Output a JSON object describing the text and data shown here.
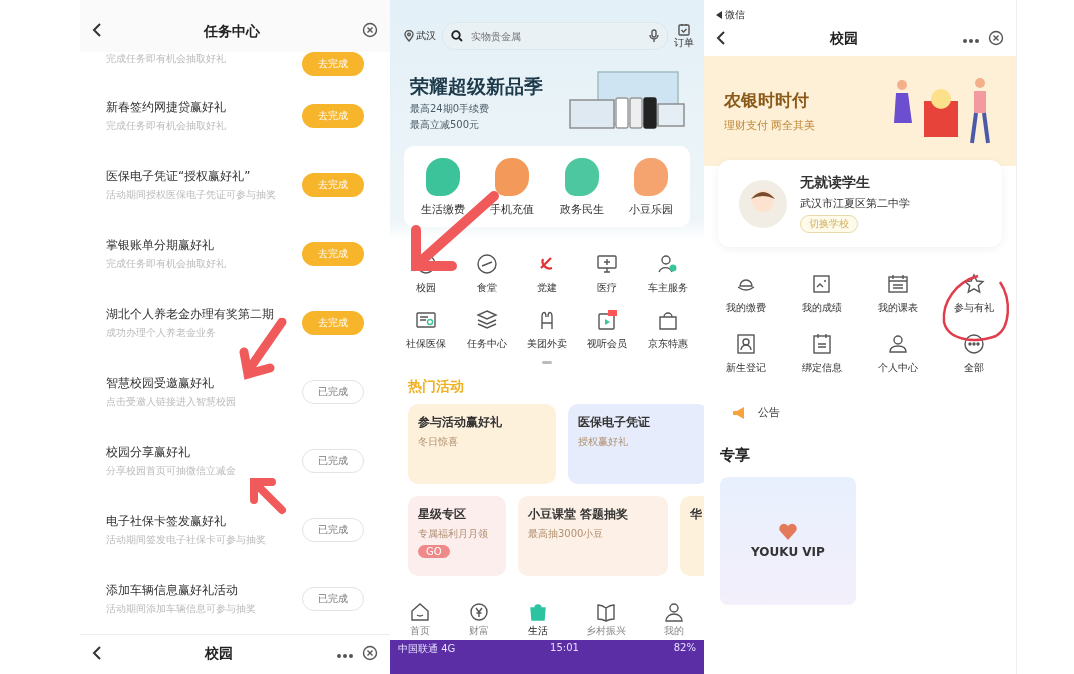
{
  "task_center": {
    "title": "任务中心",
    "tasks": [
      {
        "subtitle": "完成任务即有机会抽取好礼",
        "action": "去完成",
        "done": false
      },
      {
        "title": "新春签约网捷贷赢好礼",
        "subtitle": "完成任务即有机会抽取好礼",
        "action": "去完成",
        "done": false
      },
      {
        "title": "医保电子凭证“授权赢好礼”",
        "subtitle": "活动期间授权医保电子凭证可参与抽奖",
        "action": "去完成",
        "done": false
      },
      {
        "title": "掌银账单分期赢好礼",
        "subtitle": "完成任务即有机会抽取好礼",
        "action": "去完成",
        "done": false
      },
      {
        "title": "湖北个人养老金办理有奖第二期",
        "subtitle": "成功办理个人养老金业务",
        "action": "去完成",
        "done": false
      },
      {
        "title": "智慧校园受邀赢好礼",
        "subtitle": "点击受邀人链接进入智慧校园",
        "action": "已完成",
        "done": true
      },
      {
        "title": "校园分享赢好礼",
        "subtitle": "分享校园首页可抽微信立减金",
        "action": "已完成",
        "done": true
      },
      {
        "title": "电子社保卡签发赢好礼",
        "subtitle": "活动期间签发电子社保卡可参与抽奖",
        "action": "已完成",
        "done": true
      },
      {
        "title": "添加车辆信息赢好礼活动",
        "subtitle": "活动期间添加车辆信息可参与抽奖",
        "action": "已完成",
        "done": true
      }
    ],
    "next_header": {
      "title": "校园"
    }
  },
  "home": {
    "location": "武汉",
    "search": {
      "placeholder": "实物贵金属"
    },
    "orders_label": "订单",
    "banner": {
      "title": "荣耀超级新品季",
      "lines": [
        "最高24期0手续费",
        "最高立减500元"
      ]
    },
    "quick_services": [
      {
        "label": "生活缴费",
        "color": "#3cc39a"
      },
      {
        "label": "手机充值",
        "color": "#f39a5a"
      },
      {
        "label": "政务民生",
        "color": "#4cc7a0"
      },
      {
        "label": "小豆乐园",
        "color": "#f5a470"
      }
    ],
    "services": [
      {
        "label": "校园"
      },
      {
        "label": "食堂"
      },
      {
        "label": "党建"
      },
      {
        "label": "医疗"
      },
      {
        "label": "车主服务"
      },
      {
        "label": "社保医保"
      },
      {
        "label": "任务中心"
      },
      {
        "label": "美团外卖"
      },
      {
        "label": "视听会员"
      },
      {
        "label": "京东特惠"
      }
    ],
    "section_title": "热门活动",
    "promos": [
      {
        "title": "参与活动赢好礼",
        "subtitle": "冬日惊喜",
        "color": "#fdf1dc"
      },
      {
        "title": "医保电子凭证",
        "subtitle": "授权赢好礼",
        "color": "#e6ecfb"
      }
    ],
    "promos_row2": [
      {
        "title": "星级专区",
        "subtitle": "专属福利月月领",
        "button": "GO",
        "color": "#fdeeee"
      },
      {
        "title": "小豆课堂 答题抽奖",
        "subtitle": "最高抽3000小豆",
        "color": "#fdf0e6"
      },
      {
        "title": "华",
        "color": "#fdf1dc"
      }
    ],
    "nav": [
      {
        "label": "首页",
        "selected": false
      },
      {
        "label": "财富",
        "selected": false
      },
      {
        "label": "生活",
        "selected": true
      },
      {
        "label": "乡村振兴",
        "selected": false
      },
      {
        "label": "我的",
        "selected": false
      }
    ],
    "status_bar": {
      "carrier": "中国联通",
      "network": "4G",
      "time": "15:01",
      "battery": "82%"
    }
  },
  "campus": {
    "back_label": "微信",
    "title": "校园",
    "banner": {
      "title": "农银时时付",
      "subtitle": "理财支付 两全其美"
    },
    "profile": {
      "name": "无就读学生",
      "school": "武汉市江夏区第二中学",
      "switch_button": "切换学校"
    },
    "services": [
      {
        "label": "我的缴费"
      },
      {
        "label": "我的成绩"
      },
      {
        "label": "我的课表"
      },
      {
        "label": "参与有礼"
      },
      {
        "label": "新生登记"
      },
      {
        "label": "绑定信息"
      },
      {
        "label": "个人中心"
      },
      {
        "label": "全部"
      }
    ],
    "notice": "公告",
    "section_title": "专享",
    "card": {
      "label": "YOUKU VIP"
    }
  }
}
